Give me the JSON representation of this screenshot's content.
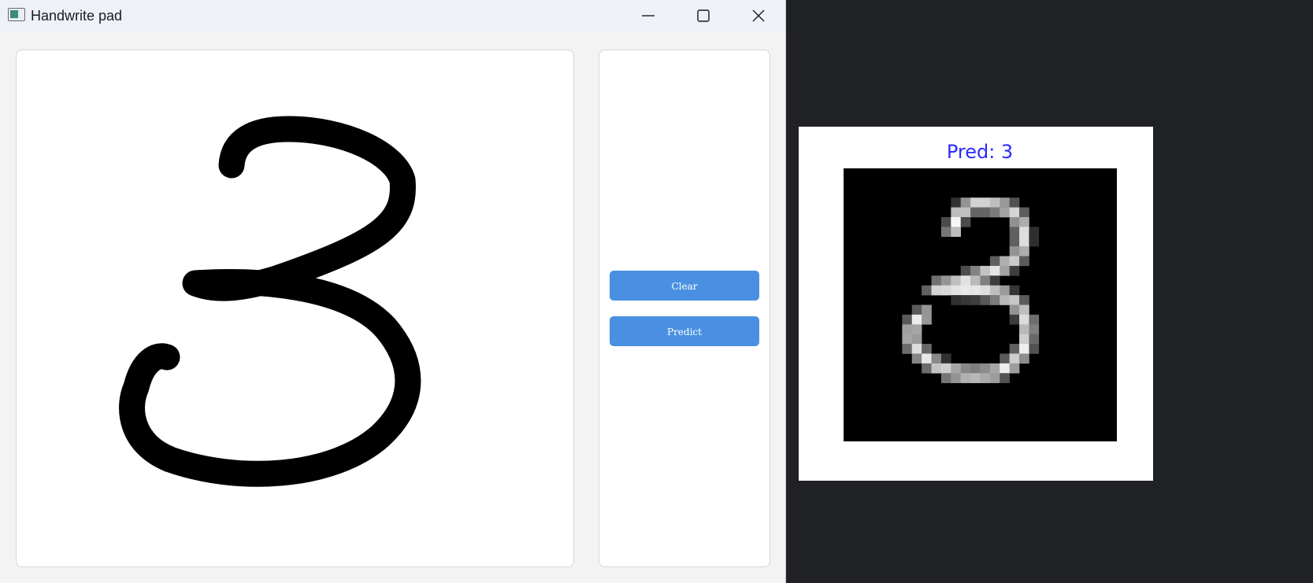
{
  "window": {
    "title": "Handwrite pad",
    "app_icon": "window-app-icon",
    "controls": {
      "minimize_icon": "minimize-icon",
      "maximize_icon": "maximize-icon",
      "close_icon": "close-icon"
    }
  },
  "canvas": {
    "drawn_digit": "3",
    "stroke_color": "#000000",
    "background_color": "#ffffff"
  },
  "controls": {
    "clear_label": "Clear",
    "predict_label": "Predict",
    "button_color": "#4a90e2"
  },
  "result": {
    "title": "Pred: 3",
    "title_color": "#2a2aff",
    "image": "28x28 grayscale digit image"
  }
}
